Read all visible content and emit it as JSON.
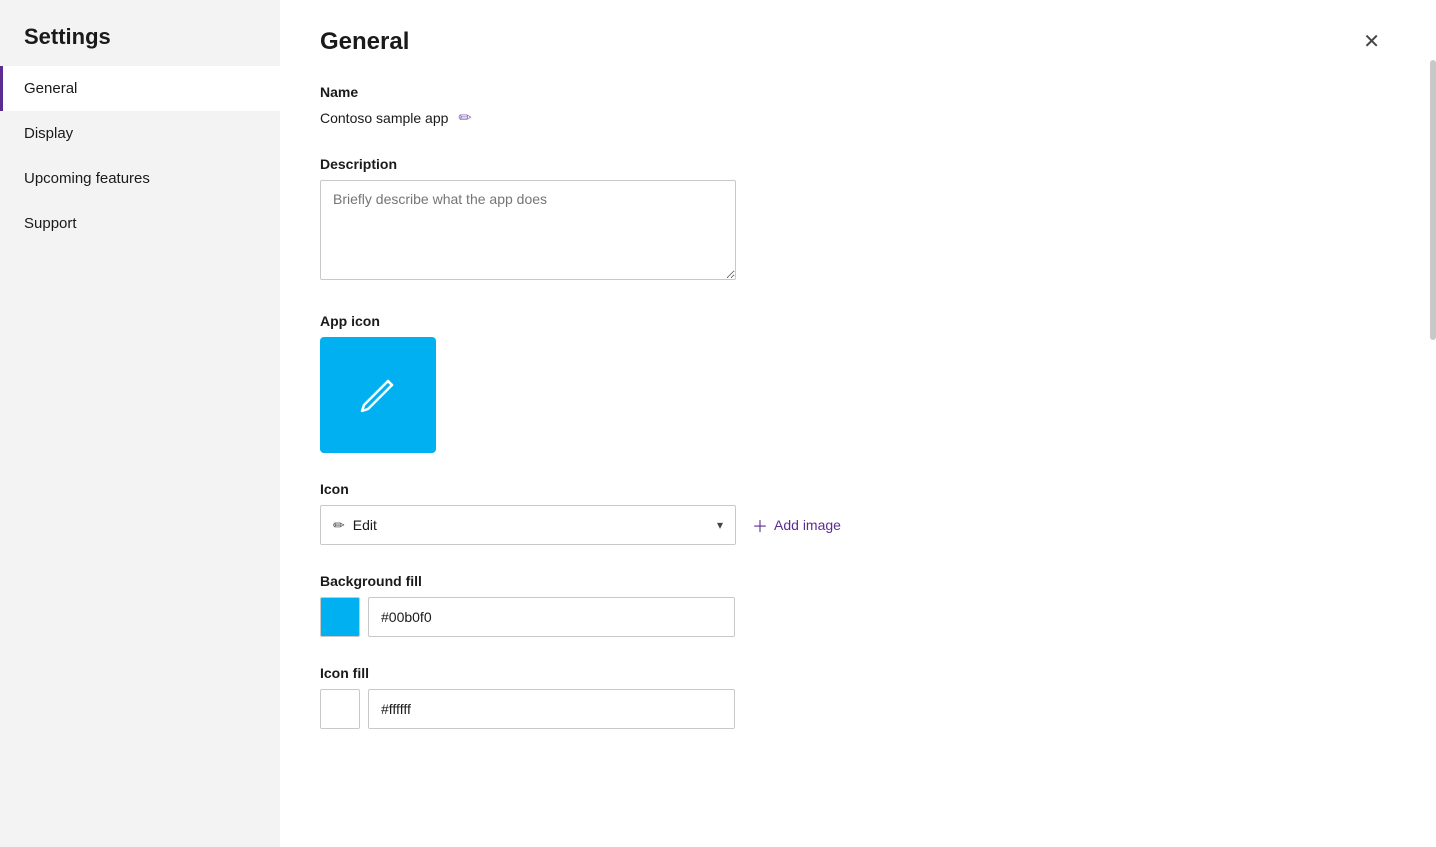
{
  "sidebar": {
    "title": "Settings",
    "nav_items": [
      {
        "id": "general",
        "label": "General",
        "active": true
      },
      {
        "id": "display",
        "label": "Display",
        "active": false
      },
      {
        "id": "upcoming-features",
        "label": "Upcoming features",
        "active": false
      },
      {
        "id": "support",
        "label": "Support",
        "active": false
      }
    ]
  },
  "main": {
    "title": "General",
    "close_button_label": "✕",
    "name_section": {
      "label": "Name",
      "value": "Contoso sample app",
      "edit_icon": "✏"
    },
    "description_section": {
      "label": "Description",
      "placeholder": "Briefly describe what the app does"
    },
    "app_icon_section": {
      "label": "App icon",
      "bg_color": "#00b0f0"
    },
    "icon_section": {
      "label": "Icon",
      "selected_value": "Edit",
      "add_image_label": "Add image"
    },
    "background_fill_section": {
      "label": "Background fill",
      "color": "#00b0f0",
      "color_value": "#00b0f0"
    },
    "icon_fill_section": {
      "label": "Icon fill",
      "color": "#ffffff",
      "color_value": "#ffffff"
    }
  }
}
